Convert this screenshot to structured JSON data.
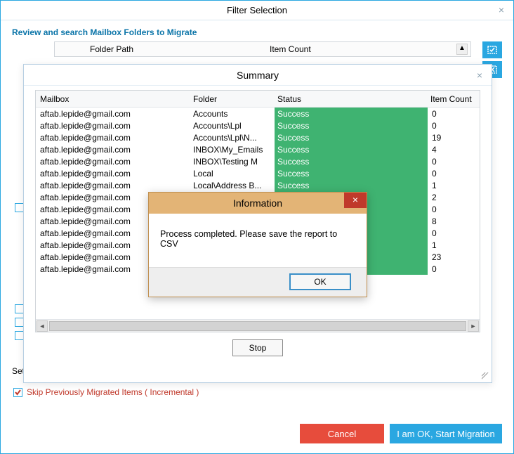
{
  "filter_window": {
    "title": "Filter Selection",
    "review_label": "Review and search Mailbox Folders to Migrate",
    "col_folder_path": "Folder Path",
    "col_item_count": "Item Count",
    "set_label": "Set",
    "skip_label": "Skip Previously Migrated Items ( Incremental )",
    "cancel_label": "Cancel",
    "start_label": "I am OK, Start Migration"
  },
  "summary_window": {
    "title": "Summary",
    "columns": {
      "mailbox": "Mailbox",
      "folder": "Folder",
      "status": "Status",
      "item_count": "Item Count"
    },
    "stop_label": "Stop",
    "rows": [
      {
        "mailbox": "aftab.lepide@gmail.com",
        "folder": "Accounts",
        "status": "Success",
        "count": "0"
      },
      {
        "mailbox": "aftab.lepide@gmail.com",
        "folder": "Accounts\\Lpl",
        "status": "Success",
        "count": "0"
      },
      {
        "mailbox": "aftab.lepide@gmail.com",
        "folder": "Accounts\\Lpl\\N...",
        "status": "Success",
        "count": "19"
      },
      {
        "mailbox": "aftab.lepide@gmail.com",
        "folder": "INBOX\\My_Emails",
        "status": "Success",
        "count": "4"
      },
      {
        "mailbox": "aftab.lepide@gmail.com",
        "folder": "INBOX\\Testing M",
        "status": "Success",
        "count": "0"
      },
      {
        "mailbox": "aftab.lepide@gmail.com",
        "folder": "Local",
        "status": "Success",
        "count": "0"
      },
      {
        "mailbox": "aftab.lepide@gmail.com",
        "folder": "Local\\Address B...",
        "status": "Success",
        "count": "1"
      },
      {
        "mailbox": "aftab.lepide@gmail.com",
        "folder": "",
        "status": "",
        "count": "2"
      },
      {
        "mailbox": "aftab.lepide@gmail.com",
        "folder": "",
        "status": "",
        "count": "0"
      },
      {
        "mailbox": "aftab.lepide@gmail.com",
        "folder": "",
        "status": "",
        "count": "8"
      },
      {
        "mailbox": "aftab.lepide@gmail.com",
        "folder": "",
        "status": "",
        "count": "0"
      },
      {
        "mailbox": "aftab.lepide@gmail.com",
        "folder": "",
        "status": "",
        "count": "1"
      },
      {
        "mailbox": "aftab.lepide@gmail.com",
        "folder": "",
        "status": "",
        "count": "23"
      },
      {
        "mailbox": "aftab.lepide@gmail.com",
        "folder": "",
        "status": "",
        "count": "0"
      }
    ]
  },
  "info_dialog": {
    "title": "Information",
    "message": "Process completed. Please save the report to CSV",
    "ok_label": "OK"
  }
}
